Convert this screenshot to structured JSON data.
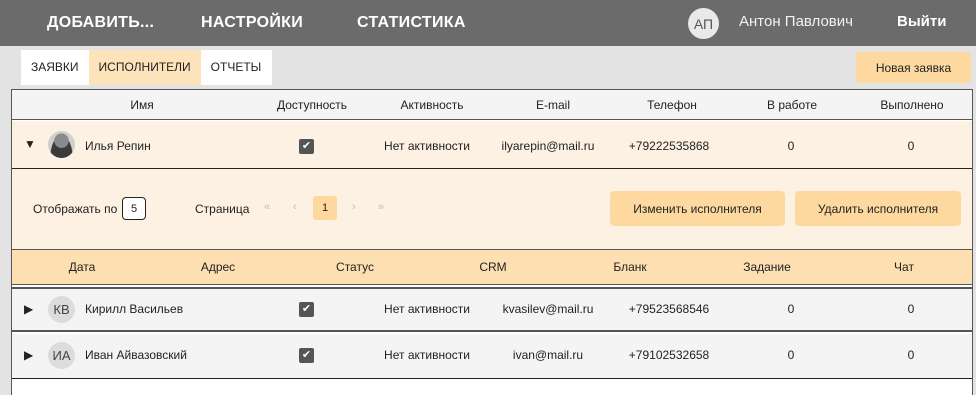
{
  "topbar": {
    "add": "ДОБАВИТЬ...",
    "settings": "НАСТРОЙКИ",
    "stats": "СТАТИСТИКА",
    "avatar_initials": "АП",
    "username": "Антон Павлович",
    "logout": "Выйти"
  },
  "tabs": [
    "ЗАЯВКИ",
    "ИСПОЛНИТЕЛИ",
    "ОТЧЕТЫ"
  ],
  "new_request": "Новая заявка",
  "columns": [
    "Имя",
    "Доступность",
    "Активность",
    "E-mail",
    "Телефон",
    "В работе",
    "Выполнено"
  ],
  "executors": [
    {
      "toggle": "▼",
      "initials": "",
      "name": "Илья Репин",
      "available": true,
      "activity": "Нет активности",
      "email": "ilyarepin@mail.ru",
      "phone": "+79222535868",
      "in_work": "0",
      "done": "0"
    },
    {
      "toggle": "▶",
      "initials": "КВ",
      "name": "Кирилл Васильев",
      "available": true,
      "activity": "Нет активности",
      "email": "kvasilev@mail.ru",
      "phone": "+79523568546",
      "in_work": "0",
      "done": "0"
    },
    {
      "toggle": "▶",
      "initials": "ИА",
      "name": "Иван Айвазовский",
      "available": true,
      "activity": "Нет активности",
      "email": "ivan@mail.ru",
      "phone": "+79102532658",
      "in_work": "0",
      "done": "0"
    }
  ],
  "detail": {
    "show_label": "Отображать по",
    "page_size": "5",
    "page_label": "Страница",
    "first": "«",
    "prev": "‹",
    "current_page": "1",
    "next": "›",
    "last": "»",
    "edit_btn": "Изменить исполнителя",
    "delete_btn": "Удалить исполнителя"
  },
  "sub_columns": [
    "Дата",
    "Адрес",
    "Статус",
    "CRM",
    "Бланк",
    "Задание",
    "Чат"
  ],
  "checkmark": "✔"
}
